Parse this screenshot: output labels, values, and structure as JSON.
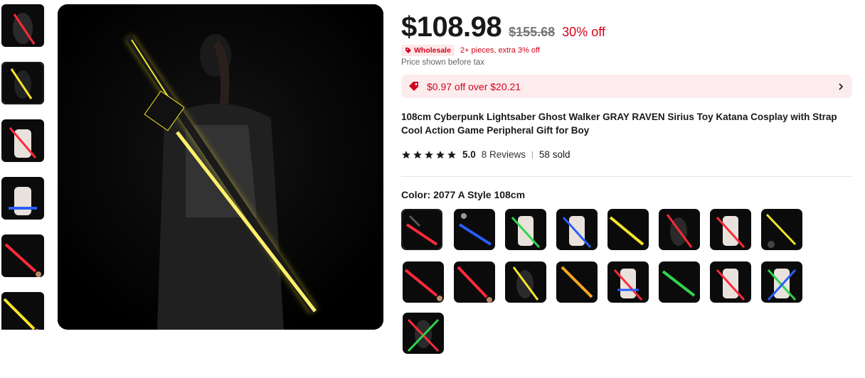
{
  "product": {
    "price": "$108.98",
    "original_price": "$155.68",
    "discount": "30% off",
    "wholesale_label": "Wholesale",
    "wholesale_text": "2+ pieces, extra 3% off",
    "tax_note": "Price shown before tax",
    "coupon_text": "$0.97 off over $20.21",
    "title": "108cm Cyberpunk Lightsaber Ghost Walker GRAY RAVEN Sirius Toy Katana Cosplay with Strap Cool Action Game Peripheral Gift for Boy",
    "rating_score": "5.0",
    "rating_stars": 5,
    "reviews": "8 Reviews",
    "sold": "58 sold",
    "color_label": "Color: 2077 A Style 108cm"
  },
  "colors": {
    "accent_red": "#d3031c",
    "coupon_bg": "#fdecee"
  },
  "icons": {
    "star": "star-icon",
    "coupon": "tag-icon",
    "chevron": "chevron-right-icon",
    "wholesale": "wholesale-tag-icon"
  }
}
